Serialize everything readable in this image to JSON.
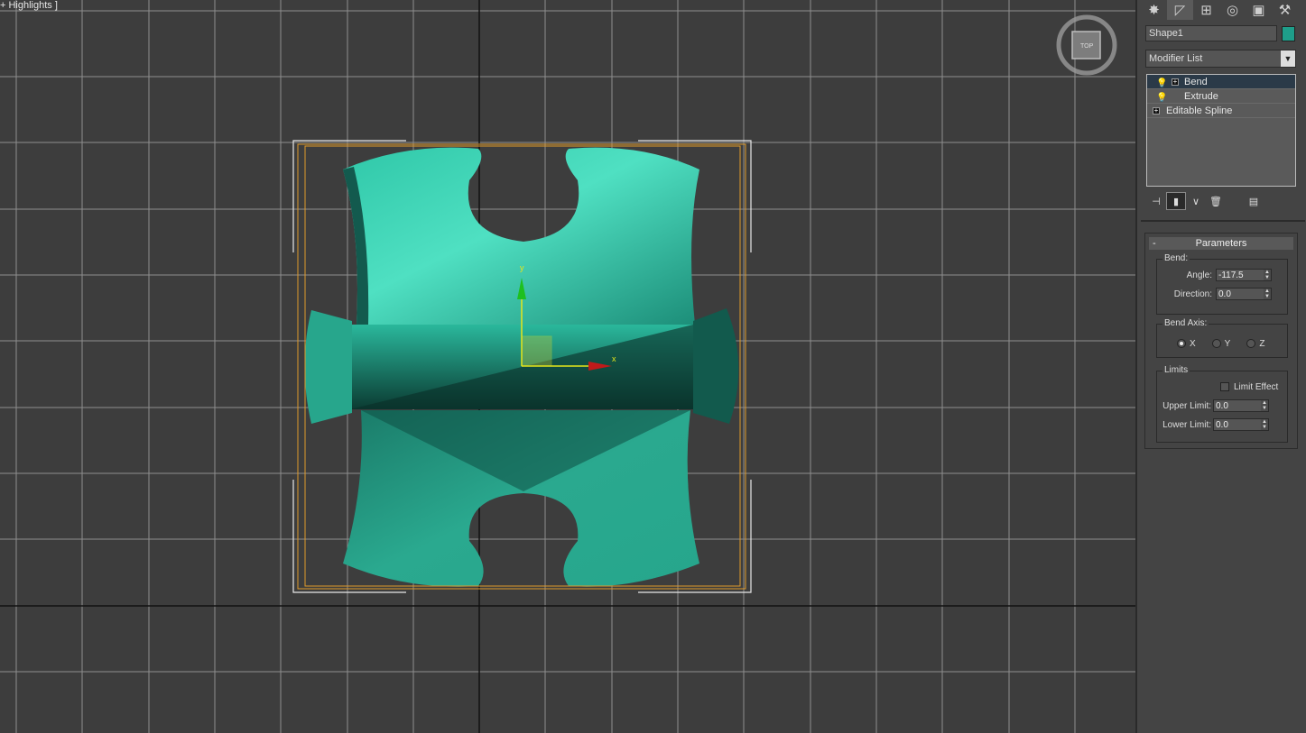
{
  "viewport": {
    "label": "+ Highlights ]"
  },
  "viewcube": {
    "face_label": "TOP"
  },
  "axis_gizmo": {
    "x_label": "x",
    "y_label": "y"
  },
  "command_tabs": [
    {
      "name": "create",
      "icon": "create-icon"
    },
    {
      "name": "modify",
      "icon": "modify-icon"
    },
    {
      "name": "hierarchy",
      "icon": "hierarchy-icon"
    },
    {
      "name": "motion",
      "icon": "motion-icon"
    },
    {
      "name": "display",
      "icon": "display-icon"
    },
    {
      "name": "utilities",
      "icon": "hammer-icon"
    }
  ],
  "object": {
    "name": "Shape1",
    "color": "#1e9e8a"
  },
  "modifier_list": {
    "label": "Modifier List"
  },
  "modifier_stack": [
    {
      "label": "Bend",
      "selected": true
    },
    {
      "label": "Extrude",
      "selected": false
    },
    {
      "label": "Editable Spline",
      "selected": false
    }
  ],
  "parameters": {
    "title": "Parameters",
    "bend_group": "Bend:",
    "angle_label": "Angle:",
    "angle_value": "-117.5",
    "direction_label": "Direction:",
    "direction_value": "0.0",
    "bend_axis_group": "Bend Axis:",
    "axis_x": "X",
    "axis_y": "Y",
    "axis_z": "Z",
    "selected_axis": "X",
    "limits_group": "Limits",
    "limit_effect_label": "Limit Effect",
    "upper_limit_label": "Upper Limit:",
    "upper_limit_value": "0.0",
    "lower_limit_label": "Lower Limit:",
    "lower_limit_value": "0.0"
  },
  "colors": {
    "viewport_bg": "#3d3d3d",
    "grid": "#9a9a9a",
    "object": "#1e9e8a",
    "selection_box": "#e09a2a"
  }
}
